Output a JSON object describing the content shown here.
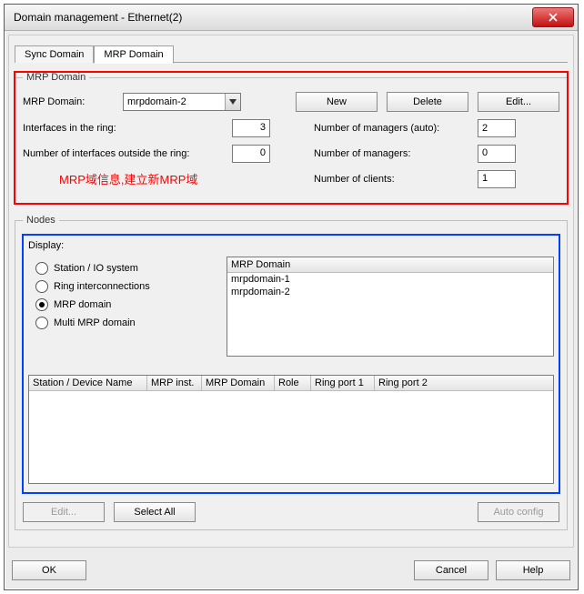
{
  "window": {
    "title": "Domain management - Ethernet(2)"
  },
  "tabs": {
    "sync": "Sync Domain",
    "mrp": "MRP Domain"
  },
  "mrp": {
    "legend": "MRP Domain",
    "domain_label": "MRP Domain:",
    "domain_value": "mrpdomain-2",
    "btn_new": "New",
    "btn_delete": "Delete",
    "btn_edit": "Edit...",
    "interfaces_in_ring_label": "Interfaces in the ring:",
    "interfaces_in_ring_value": "3",
    "interfaces_outside_label": "Number of interfaces outside the ring:",
    "interfaces_outside_value": "0",
    "managers_auto_label": "Number of managers (auto):",
    "managers_auto_value": "2",
    "managers_label": "Number of managers:",
    "managers_value": "0",
    "clients_label": "Number of clients:",
    "clients_value": "1",
    "annotation": "MRP域信息,建立新MRP域"
  },
  "nodes": {
    "legend": "Nodes",
    "display_label": "Display:",
    "radio_station_io": "Station / IO system",
    "radio_ring_inter": "Ring interconnections",
    "radio_mrp_domain": "MRP domain",
    "radio_multi_mrp": "Multi MRP domain",
    "list_header": "MRP Domain",
    "list_items": [
      "mrpdomain-1",
      "mrpdomain-2"
    ],
    "cols": {
      "c1": "Station / Device Name",
      "c2": "MRP inst.",
      "c3": "MRP Domain",
      "c4": "Role",
      "c5": "Ring port 1",
      "c6": "Ring port 2"
    },
    "btn_edit": "Edit...",
    "btn_select_all": "Select All",
    "btn_auto": "Auto config"
  },
  "dialog": {
    "ok": "OK",
    "cancel": "Cancel",
    "help": "Help"
  }
}
